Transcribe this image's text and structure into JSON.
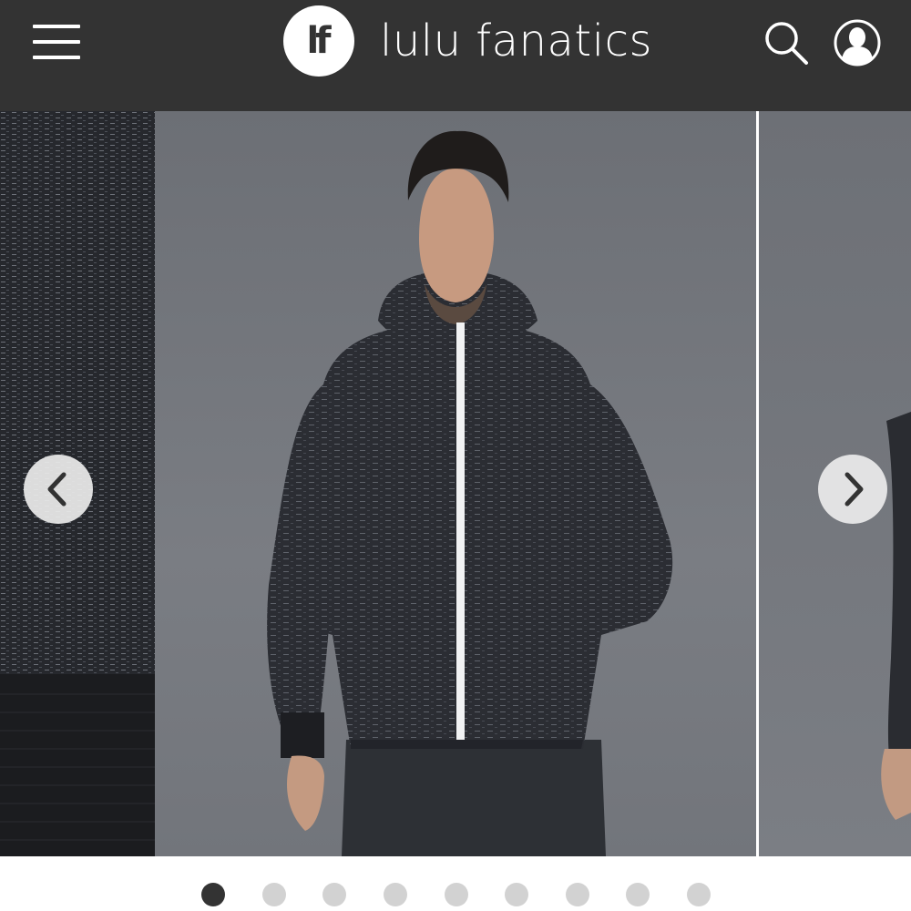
{
  "header": {
    "logo_text": "lf",
    "brand_name": "lulu fanatics",
    "icons": [
      "hamburger-menu-icon",
      "search-icon",
      "user-profile-icon"
    ]
  },
  "carousel": {
    "slide_count": 9,
    "active_index": 0,
    "icons": [
      "chevron-left-icon",
      "chevron-right-icon"
    ]
  },
  "colors": {
    "header_bg": "#333333",
    "dot_active": "#333333",
    "dot_inactive": "#d2d2d2"
  }
}
